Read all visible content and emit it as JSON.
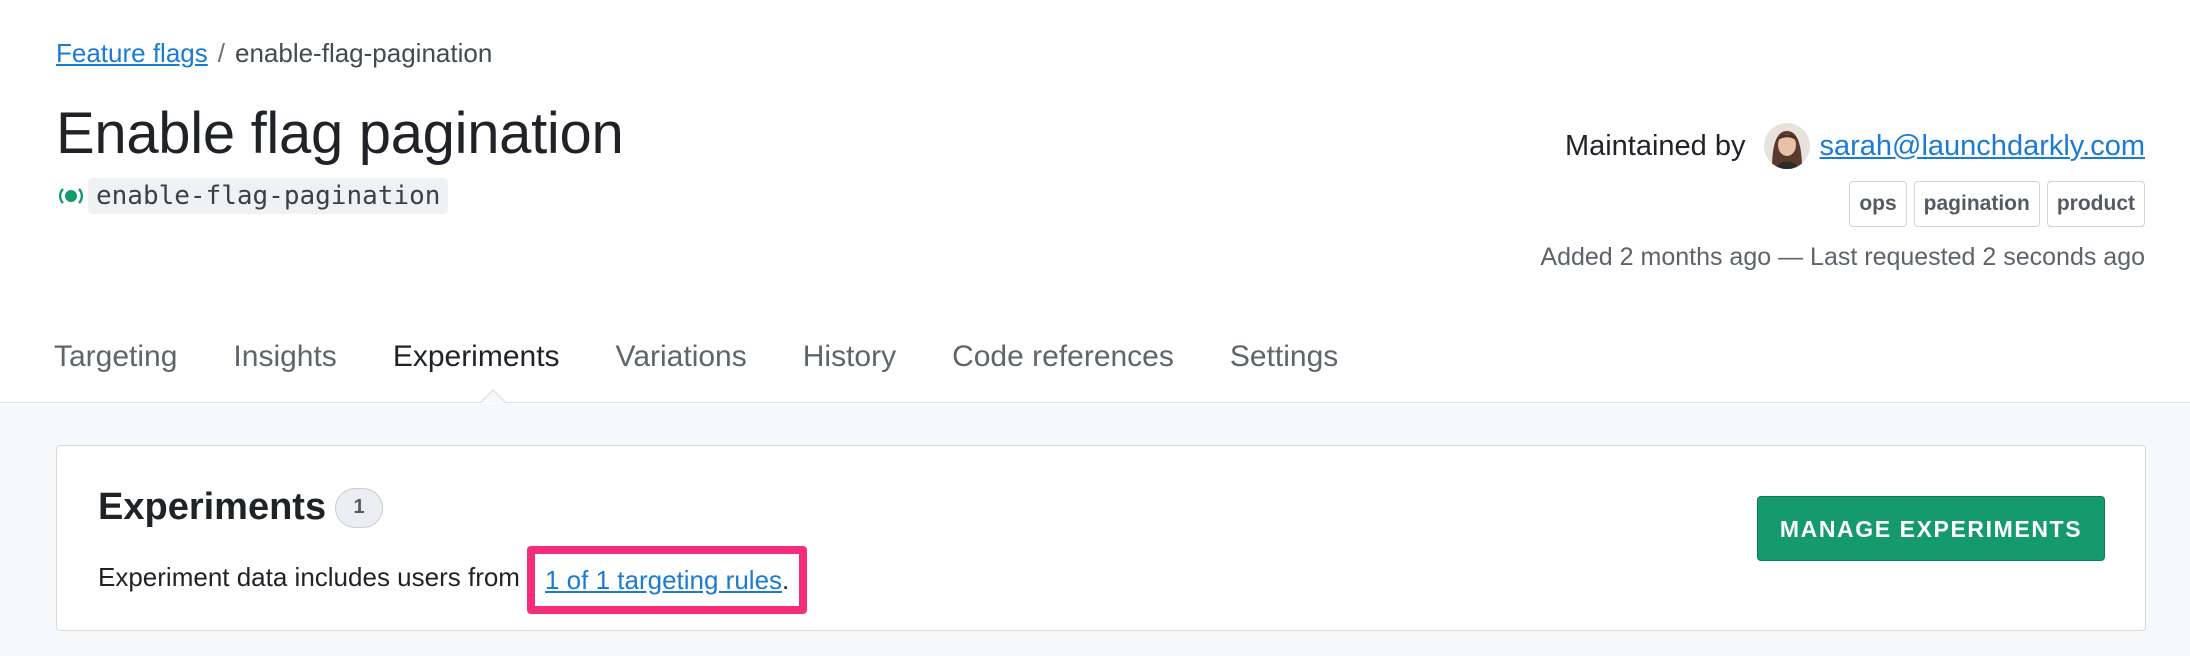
{
  "breadcrumb": {
    "root_link": "Feature flags",
    "separator": "/",
    "current": "enable-flag-pagination"
  },
  "flag": {
    "title": "Enable flag pagination",
    "key": "enable-flag-pagination",
    "status_icon": "live-status-icon",
    "status_color": "#159a6e"
  },
  "maintainer": {
    "label": "Maintained by",
    "email": "sarah@launchdarkly.com",
    "avatar_icon": "avatar"
  },
  "tags": [
    "ops",
    "pagination",
    "product"
  ],
  "meta_line": "Added 2 months ago — Last requested 2 seconds ago",
  "tabs": [
    {
      "label": "Targeting",
      "active": false
    },
    {
      "label": "Insights",
      "active": false
    },
    {
      "label": "Experiments",
      "active": true
    },
    {
      "label": "Variations",
      "active": false
    },
    {
      "label": "History",
      "active": false
    },
    {
      "label": "Code references",
      "active": false
    },
    {
      "label": "Settings",
      "active": false
    }
  ],
  "experiments_card": {
    "title": "Experiments",
    "count": "1",
    "desc_prefix": "Experiment data includes users from",
    "rules_link": "1 of 1 targeting rules",
    "desc_suffix": ".",
    "manage_button": "MANAGE EXPERIMENTS",
    "highlight_color": "#f62d7a",
    "button_color": "#159a6e"
  }
}
